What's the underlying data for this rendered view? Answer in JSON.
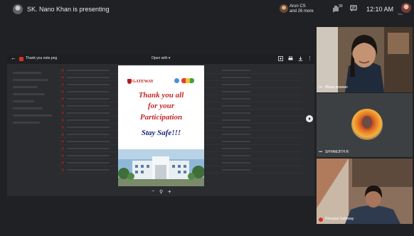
{
  "topbar": {
    "presenting_text": "SK. Nano Khan is presenting",
    "participants_line1": "Arun CS",
    "participants_line2": "and 26 more",
    "hand_count": "30",
    "clock": "12:10 AM",
    "self_label": "You"
  },
  "viewer": {
    "file_name": "Thank you note.png",
    "open_with": "Open with ▾",
    "back_icon": "back-arrow-icon",
    "menu_glyph": "⋮"
  },
  "slide": {
    "logo_text": "GATEWAY",
    "line1": "Thank you all",
    "line2": "for your",
    "line3": "Participation",
    "line4": "Stay Safe!!!"
  },
  "zoom": {
    "out": "−",
    "magnifier": "⚲",
    "in": "+"
  },
  "tiles": [
    {
      "name": "Bhara keswan",
      "more": "•••"
    },
    {
      "name": "SHYAMJITH R",
      "more": "•••"
    },
    {
      "name": "Principal Gateway",
      "more": ""
    }
  ],
  "colors": {
    "background": "#202124",
    "accent_red": "#d93025",
    "slide_red": "#c62828",
    "slide_blue": "#1a237e"
  }
}
